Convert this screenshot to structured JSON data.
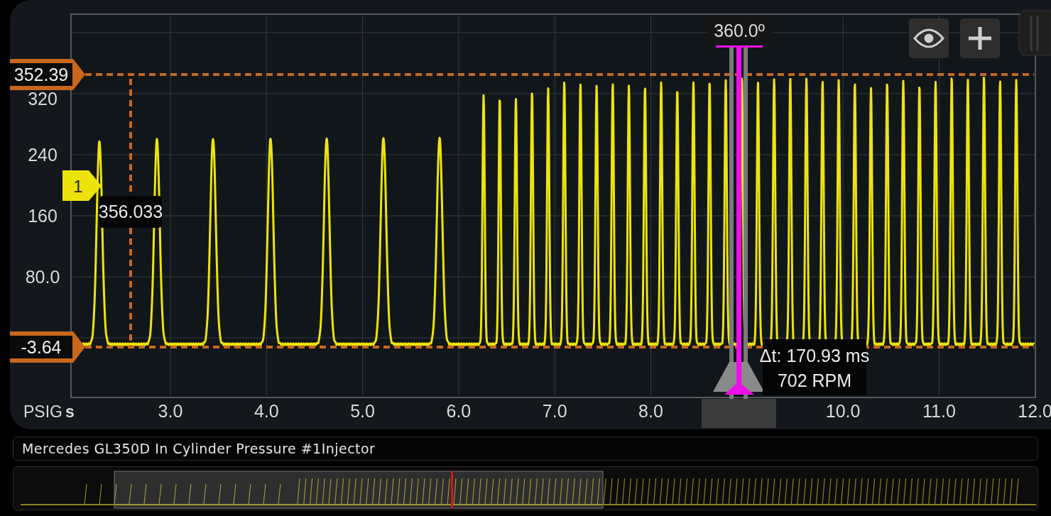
{
  "plot": {
    "y_unit": "PSIG",
    "x_unit": "s",
    "yticks": [
      "320",
      "240",
      "160",
      "80.0"
    ],
    "xticks": [
      "3.0",
      "4.0",
      "5.0",
      "6.0",
      "7.0",
      "8.0",
      "10.0",
      "11.0",
      "12.0"
    ],
    "level_cursors": [
      {
        "label": "352.39"
      },
      {
        "label": "-3.64"
      }
    ],
    "channel_marker": "1",
    "readout": "356.033",
    "phase_cursor": "360.0º",
    "delta": {
      "time": "Δt: 170.93 ms",
      "rpm": "702 RPM"
    }
  },
  "toolbar": [
    {
      "kind": "eye"
    },
    {
      "kind": "add"
    }
  ],
  "title": "Mercedes GL350D In Cylinder Pressure #1Injector"
}
